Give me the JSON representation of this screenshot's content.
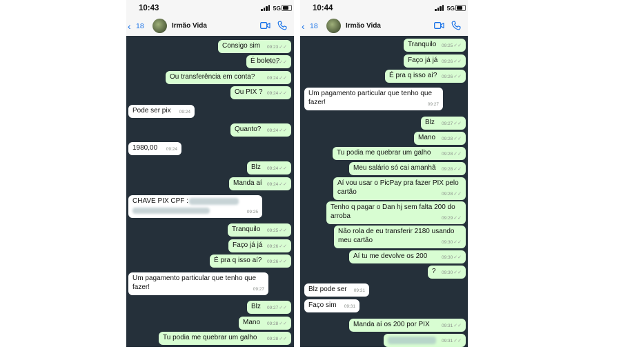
{
  "left": {
    "status": {
      "time": "10:43",
      "network": "5G"
    },
    "header": {
      "back_count": "18",
      "contact": "Irmão Vida"
    },
    "messages": [
      {
        "text": "Consigo sim",
        "time": "09:23"
      },
      {
        "text": "É boleto?",
        "time": "09:23"
      },
      {
        "text": "Ou transferência em conta?",
        "time": "09:24"
      },
      {
        "text": "Ou PIX ?",
        "time": "09:24"
      },
      {
        "text": "Pode ser pix",
        "time": "09:24"
      },
      {
        "text": "Quanto?",
        "time": "09:24"
      },
      {
        "text": "1980,00",
        "time": "09:24"
      },
      {
        "text": "Blz",
        "time": "09:24"
      },
      {
        "text": "Manda aí",
        "time": "09:24"
      },
      {
        "text": "CHAVE PIX CPF :",
        "time": "09:25"
      },
      {
        "text": "Tranquilo",
        "time": "09:25"
      },
      {
        "text": "Faço já já",
        "time": "09:26"
      },
      {
        "text": "É pra q isso aí?",
        "time": "09:26"
      },
      {
        "text": "Um pagamento particular que tenho que fazer!",
        "time": "09:27"
      },
      {
        "text": "Blz",
        "time": "09:27"
      },
      {
        "text": "Mano",
        "time": "09:28"
      },
      {
        "text": "Tu podia me quebrar um galho",
        "time": "09:28"
      }
    ]
  },
  "right": {
    "status": {
      "time": "10:44",
      "network": "5G"
    },
    "header": {
      "back_count": "18",
      "contact": "Irmão Vida"
    },
    "messages": [
      {
        "text": "Tranquilo",
        "time": "09:25"
      },
      {
        "text": "Faço já já",
        "time": "09:26"
      },
      {
        "text": "É pra q isso aí?",
        "time": "09:26"
      },
      {
        "text": "Um pagamento particular que tenho que fazer!",
        "time": "09:27"
      },
      {
        "text": "Blz",
        "time": "09:27"
      },
      {
        "text": "Mano",
        "time": "09:28"
      },
      {
        "text": "Tu podia me quebrar um galho",
        "time": "09:28"
      },
      {
        "text": "Meu salário só cai amanhã",
        "time": "09:28"
      },
      {
        "text": "Aí vou usar o PicPay pra fazer PIX pelo cartão",
        "time": "09:28"
      },
      {
        "text": "Tenho q pagar o Dan hj sem falta 200 do arroba",
        "time": "09:29"
      },
      {
        "text": "Não rola de eu transferir 2180 usando meu cartão",
        "time": "09:30"
      },
      {
        "text": "Aí tu me devolve os 200",
        "time": "09:30"
      },
      {
        "text": "?",
        "time": "09:30"
      },
      {
        "text": "Blz pode ser",
        "time": "09:31"
      },
      {
        "text": "Faço sim",
        "time": "09:31"
      },
      {
        "text": "Manda aí os 200 por PIX",
        "time": "09:31"
      },
      {
        "text": "",
        "time": "09:31"
      }
    ]
  },
  "colors": {
    "chat_bg": "#25303a",
    "outgoing": "#d8fdd2",
    "incoming": "#ffffff",
    "accent": "#1a73e8"
  },
  "icons": {
    "back": "chevron-left-icon",
    "video": "video-call-icon",
    "call": "phone-call-icon",
    "read": "double-check-icon"
  }
}
